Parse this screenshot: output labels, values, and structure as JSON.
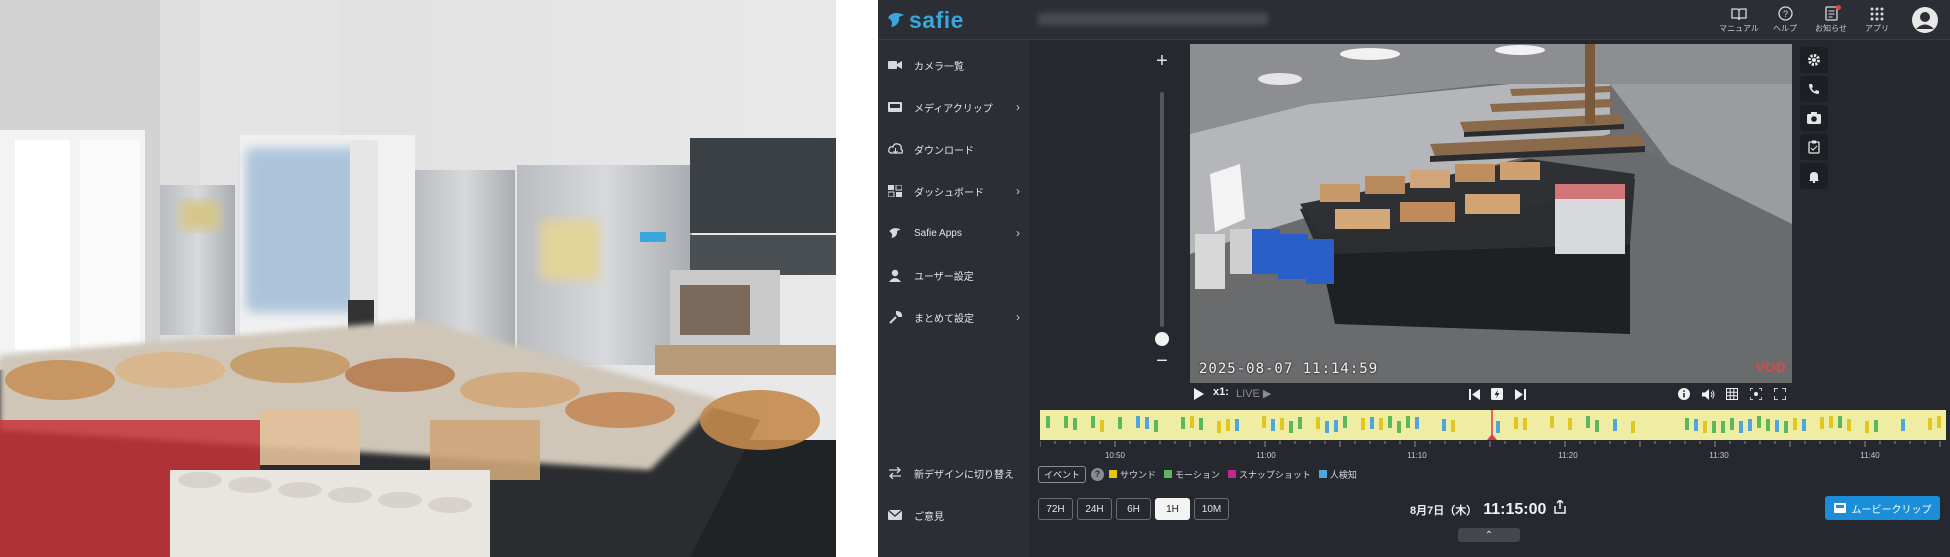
{
  "app": {
    "logo_text": "safie",
    "accent": "#3aa7dc"
  },
  "topnav": [
    {
      "label": "マニュアル",
      "icon": "manual-icon"
    },
    {
      "label": "ヘルプ",
      "icon": "help-icon"
    },
    {
      "label": "お知らせ",
      "icon": "notification-icon"
    },
    {
      "label": "アプリ",
      "icon": "apps-grid-icon"
    }
  ],
  "sidebar": {
    "items": [
      {
        "label": "カメラ一覧",
        "icon": "camera-icon"
      },
      {
        "label": "メディアクリップ",
        "icon": "media-clip-icon",
        "submenu": true
      },
      {
        "label": "ダウンロード",
        "icon": "cloud-download-icon"
      },
      {
        "label": "ダッシュボード",
        "icon": "dashboard-icon",
        "submenu": true
      },
      {
        "label": "Safie Apps",
        "icon": "safie-apps-icon",
        "submenu": true
      },
      {
        "label": "ユーザー設定",
        "icon": "user-icon"
      },
      {
        "label": "まとめて設定",
        "icon": "wrench-icon",
        "submenu": true
      }
    ],
    "bottom": [
      {
        "label": "新デザインに切り替え",
        "icon": "switch-icon"
      },
      {
        "label": "ご意見",
        "icon": "mail-icon"
      }
    ]
  },
  "video": {
    "timestamp": "2025-08-07  11:14:59",
    "mode_badge": "VOD"
  },
  "player": {
    "speed": "x1:",
    "live": "LIVE ▶"
  },
  "timeline": {
    "labels": [
      "10:50",
      "11:00",
      "11:10",
      "11:20",
      "11:30",
      "11:40"
    ],
    "legend_button": "イベント",
    "help": "?",
    "legend": [
      {
        "label": "サウンド",
        "color": "#e2c620"
      },
      {
        "label": "モーション",
        "color": "#5cb85c"
      },
      {
        "label": "スナップショット",
        "color": "#c02a8c"
      },
      {
        "label": "人検知",
        "color": "#4fa6de"
      }
    ]
  },
  "ranges": [
    "72H",
    "24H",
    "6H",
    "1H",
    "10M"
  ],
  "active_range": "1H",
  "current": {
    "date": "8月7日（木）",
    "time": "11:15:00"
  },
  "movie_clip_button": "ムービークリップ",
  "drawer_label": "⌃"
}
